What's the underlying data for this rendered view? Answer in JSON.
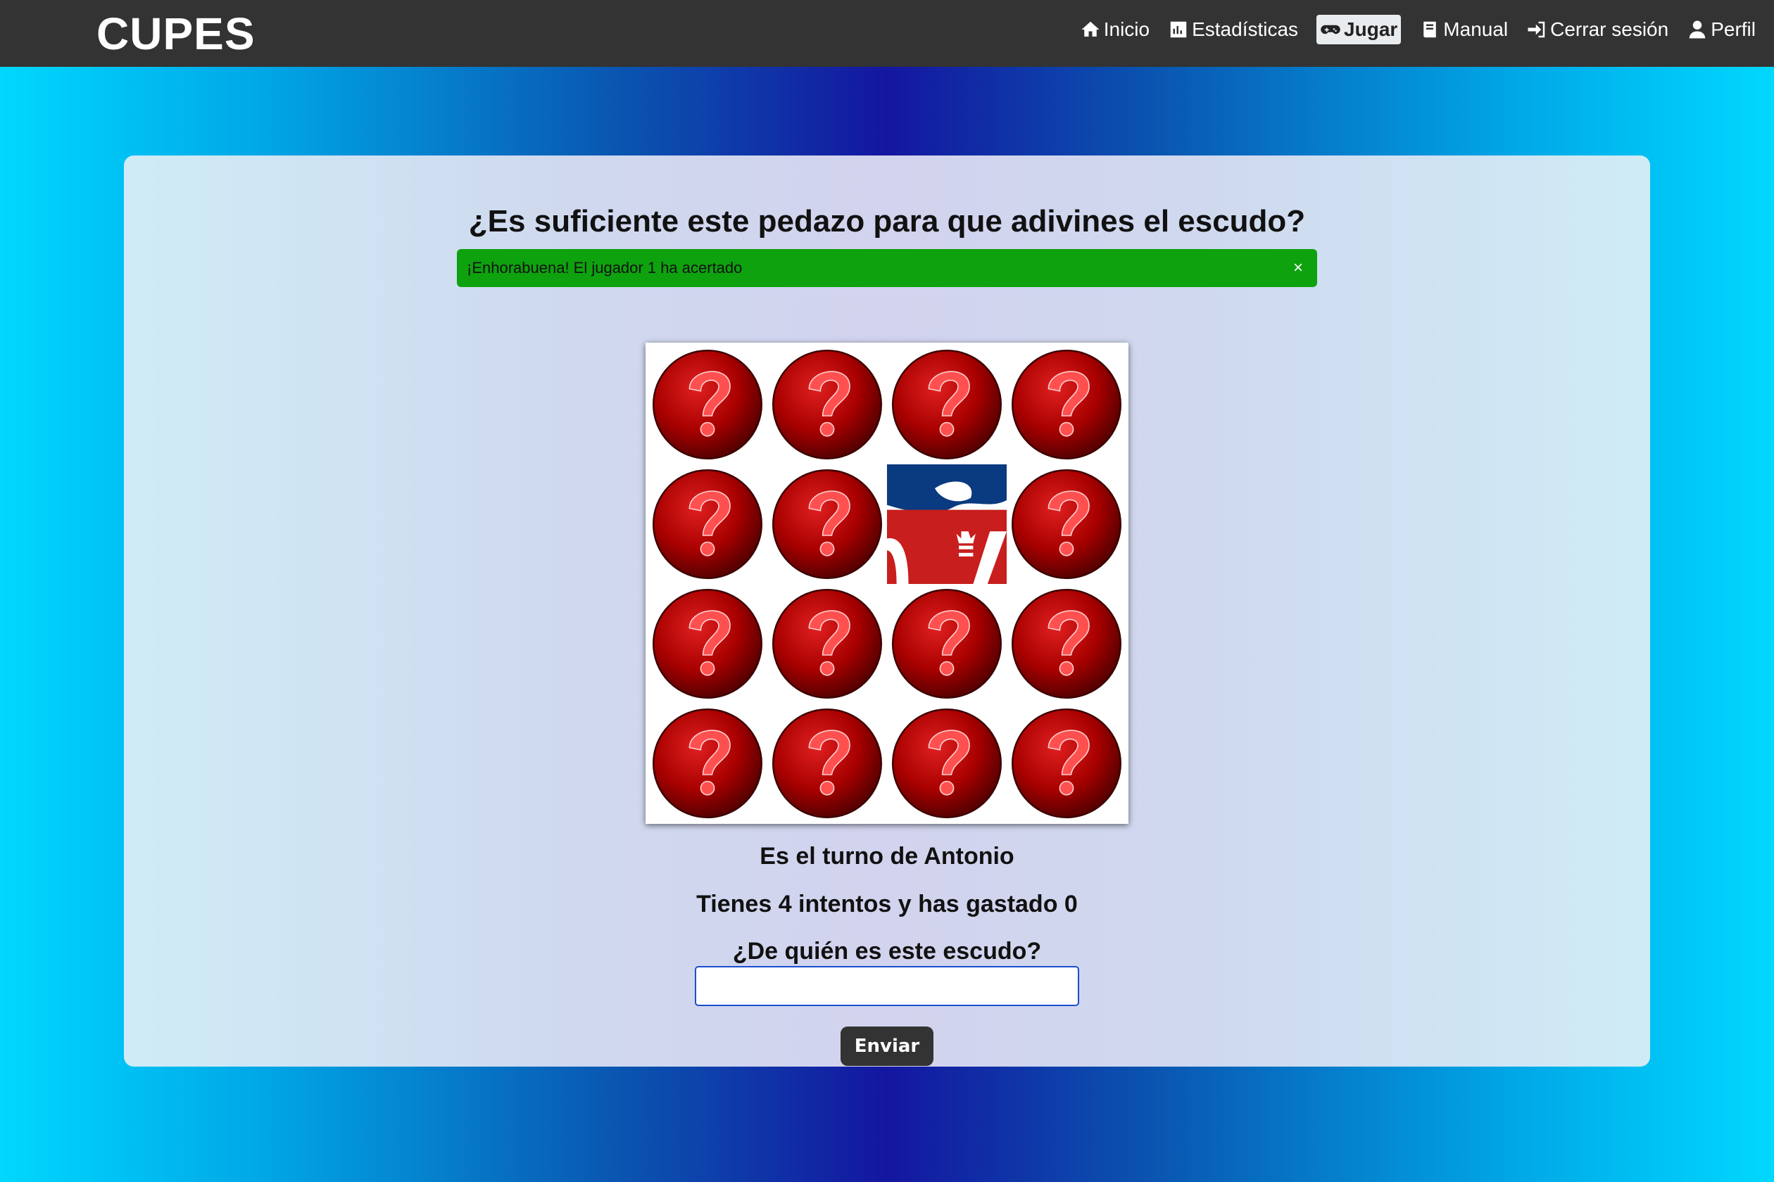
{
  "navbar": {
    "brand": "CUPES",
    "links": [
      {
        "label": "Inicio",
        "icon": "home-icon"
      },
      {
        "label": "Estadísticas",
        "icon": "chart-icon"
      },
      {
        "label": "Jugar",
        "icon": "gamepad-icon",
        "active": true
      },
      {
        "label": "Manual",
        "icon": "book-icon"
      },
      {
        "label": "Cerrar sesión",
        "icon": "sign-out-icon"
      },
      {
        "label": "Perfil",
        "icon": "user-icon"
      }
    ]
  },
  "game": {
    "title": "¿Es suficiente este pedazo para que adivines el escudo?",
    "alert": {
      "text": "¡Enhorabuena! El jugador 1 ha acertado",
      "close": "×",
      "color": "#0ea20e"
    },
    "board": {
      "rows": 4,
      "cols": 4,
      "revealed": [
        [
          1,
          2
        ]
      ],
      "hidden_icon": "question-mark-icon",
      "revealed_icon": "crest-fragment-icon"
    },
    "turn_text": "Es el turno de Antonio",
    "attempts_text": "Tienes 4 intentos y has gastado 0",
    "question_text": "¿De quién es este escudo?",
    "answer": {
      "value": "",
      "placeholder": ""
    },
    "submit_label": "Enviar"
  },
  "colors": {
    "navbar": "#333333",
    "accent_success": "#0ea20e",
    "tile_red": "#b40000",
    "crest_blue": "#0a3a80",
    "crest_red": "#c81e1e"
  }
}
